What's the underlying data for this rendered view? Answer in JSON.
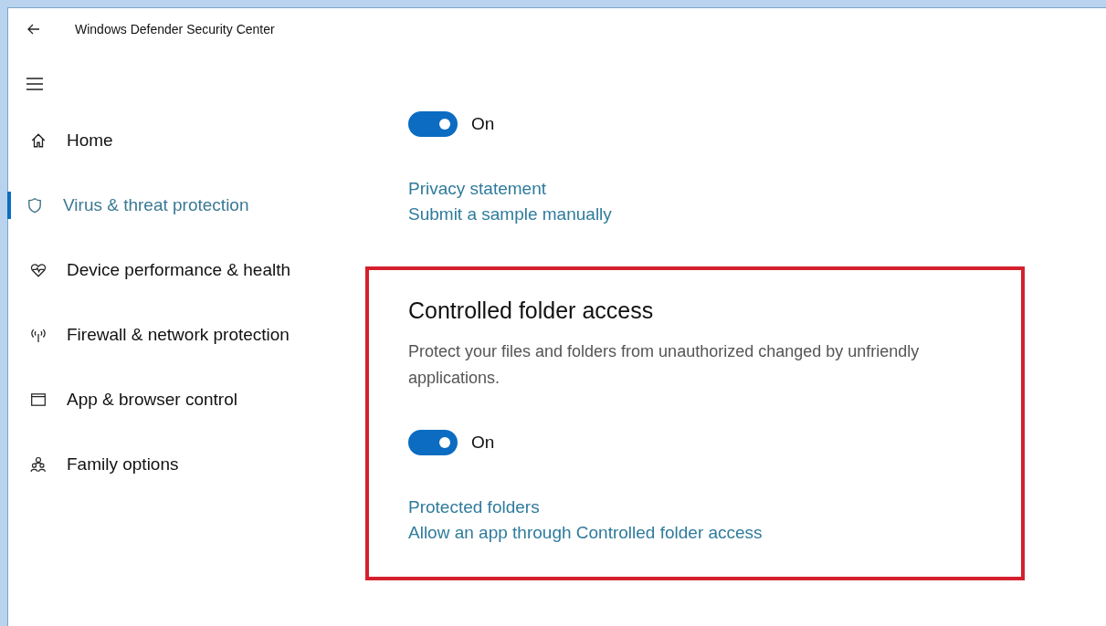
{
  "window": {
    "title": "Windows Defender Security Center"
  },
  "sidebar": {
    "items": [
      {
        "label": "Home",
        "kind": "home",
        "selected": false
      },
      {
        "label": "Virus & threat protection",
        "kind": "shield",
        "selected": true
      },
      {
        "label": "Device performance & health",
        "kind": "heart",
        "selected": false
      },
      {
        "label": "Firewall & network protection",
        "kind": "antenna",
        "selected": false
      },
      {
        "label": "App & browser control",
        "kind": "window",
        "selected": false
      },
      {
        "label": "Family options",
        "kind": "family",
        "selected": false
      }
    ]
  },
  "top_setting": {
    "toggle": {
      "on": true,
      "label": "On"
    },
    "links": [
      "Privacy statement",
      "Submit a sample manually"
    ]
  },
  "controlled_folder_access": {
    "highlighted": true,
    "title": "Controlled folder access",
    "description": "Protect your files and folders from unauthorized changed by unfriendly applications.",
    "toggle": {
      "on": true,
      "label": "On"
    },
    "links": [
      "Protected folders",
      "Allow an app through Controlled folder access"
    ]
  }
}
